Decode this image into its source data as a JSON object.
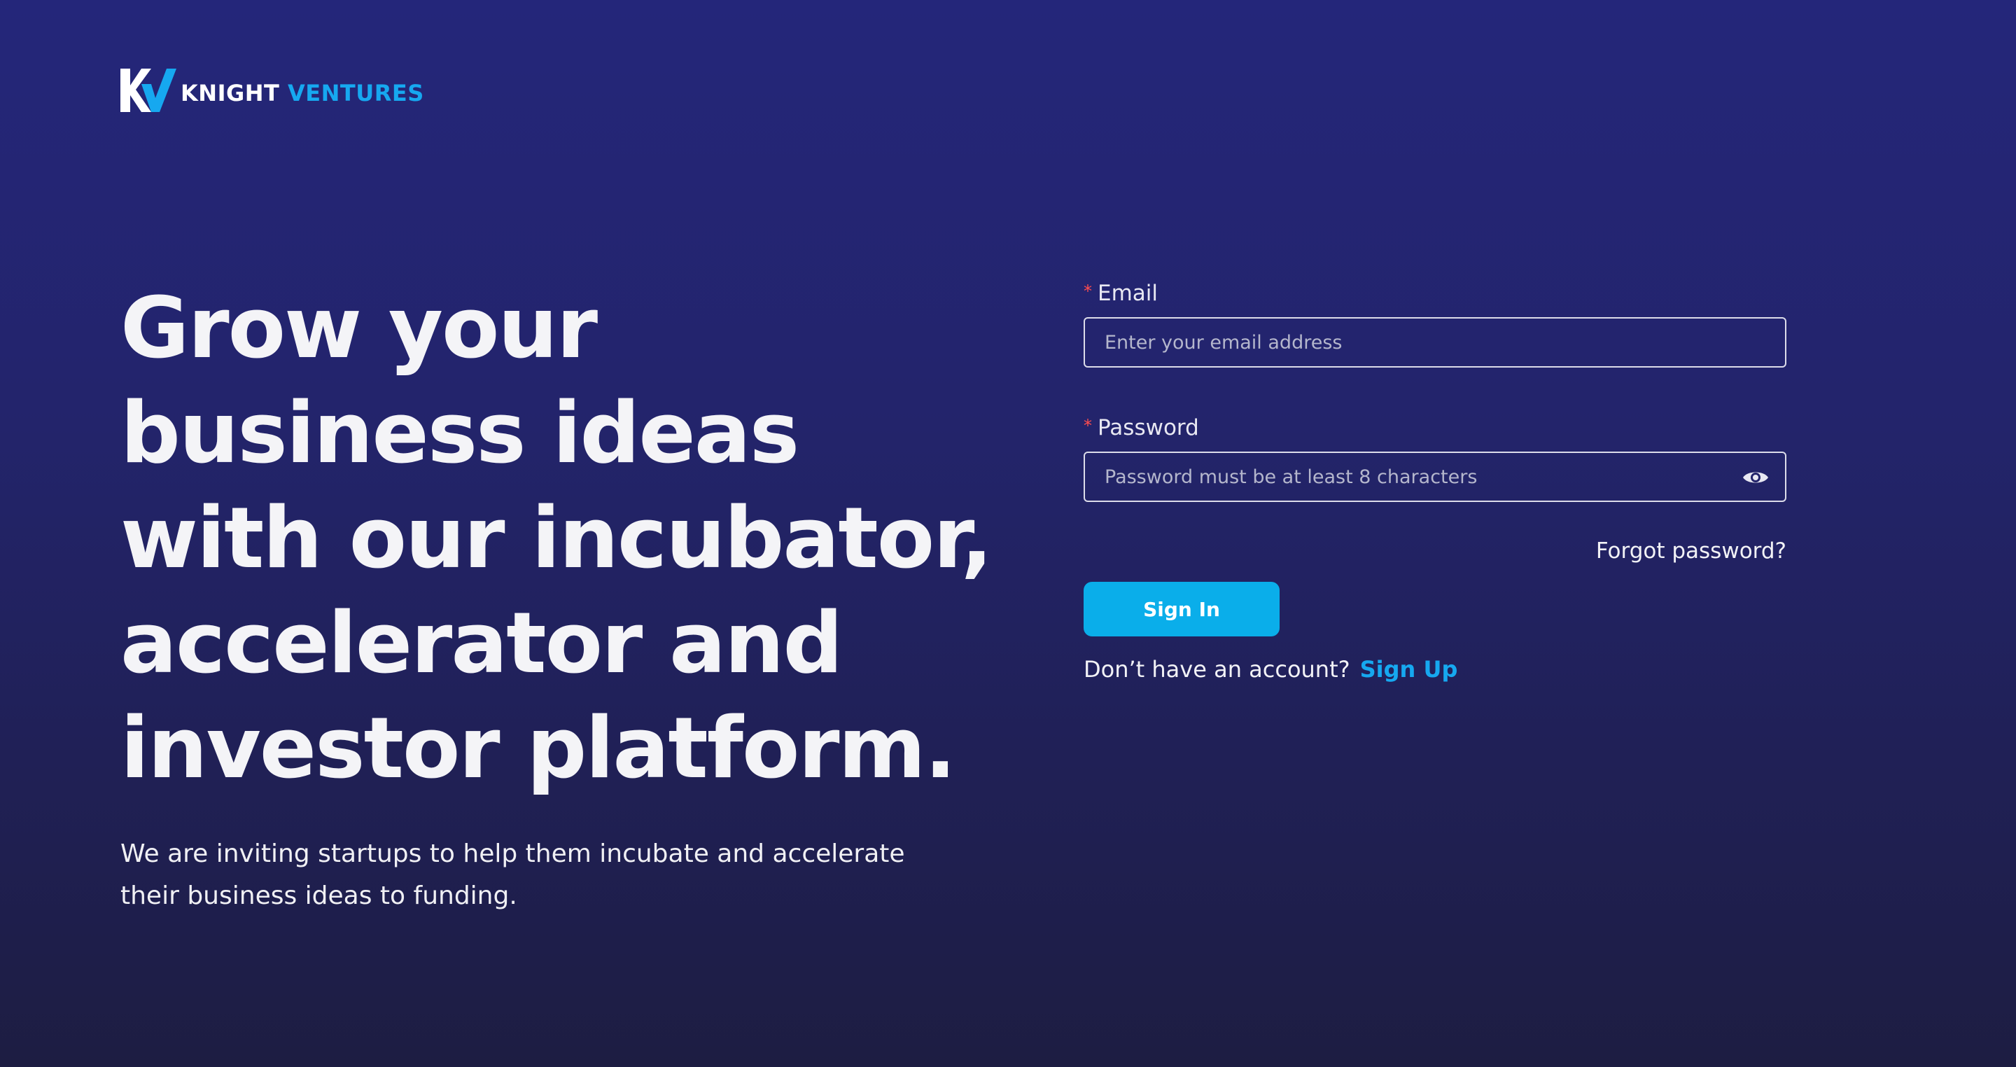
{
  "brand": {
    "word1": "KNIGHT",
    "word2": "VENTURES",
    "colors": {
      "primary": "#ffffff",
      "accent": "#16a8f0"
    }
  },
  "hero": {
    "headline_lines": [
      "Grow your",
      "business ideas",
      "with our incubator,",
      "accelerator and",
      "investor platform."
    ],
    "subtext": "We are inviting startups to help them incubate and accelerate their business ideas to funding."
  },
  "form": {
    "email": {
      "required_mark": "*",
      "label": "Email",
      "placeholder": "Enter your email address",
      "value": ""
    },
    "password": {
      "required_mark": "*",
      "label": "Password",
      "placeholder": "Password must be at least 8 characters",
      "value": "",
      "toggle_icon": "eye-icon"
    },
    "forgot_label": "Forgot password?",
    "signin_label": "Sign In",
    "signup_prompt": "Don’t have an account?",
    "signup_label": "Sign Up"
  },
  "colors": {
    "background_top": "#24267a",
    "background_bottom": "#1d1d42",
    "button": "#0aaeea",
    "required": "#ff4d4f",
    "link": "#16a8f0"
  }
}
